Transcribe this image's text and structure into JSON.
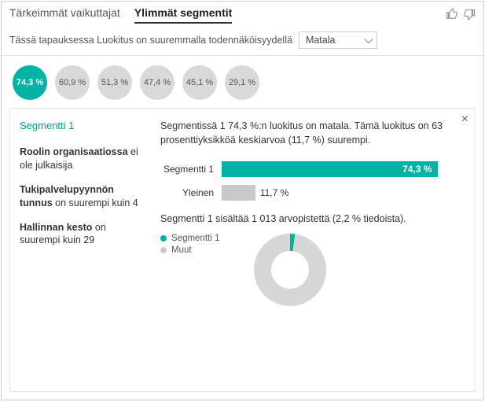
{
  "tabs": {
    "tab1": "Tärkeimmät vaikuttajat",
    "tab2": "Ylimmät segmentit"
  },
  "sub_sentence": "Tässä tapauksessa Luokitus on suuremmalla todennäköisyydellä",
  "dropdown_value": "Matala",
  "bubbles": [
    "74,3 %",
    "60,9 %",
    "51,3 %",
    "47,4 %",
    "45,1 %",
    "29,1 %"
  ],
  "segment": {
    "title": "Segmentti 1",
    "conditions": [
      {
        "bold": "Roolin organisaatiossa",
        "rest": " ei ole julkaisija"
      },
      {
        "bold": "Tukipalvelupyynnön tunnus",
        "rest": " on suurempi kuin 4"
      },
      {
        "bold": "Hallinnan kesto",
        "rest": " on suurempi kuin 29"
      }
    ]
  },
  "summary": "Segmentissä 1 74,3 %:n luokitus on matala. Tämä luokitus on 63 prosenttiyksikköä keskiarvoa (11,7 %) suurempi.",
  "bars": {
    "seg_label": "Segmentti 1",
    "seg_value": "74,3 %",
    "all_label": "Yleinen",
    "all_value": "11,7 %"
  },
  "points_text": "Segmentti 1 sisältää 1 013 arvopistettä (2,2 % tiedoista).",
  "legend": {
    "seg": "Segmentti 1",
    "other": "Muut"
  },
  "chart_data": {
    "type": "bar",
    "title": "",
    "categories": [
      "Segmentti 1",
      "Yleinen"
    ],
    "values": [
      74.3,
      11.7
    ],
    "xlabel": "",
    "ylabel": "%",
    "ylim": [
      0,
      100
    ],
    "donut": {
      "type": "pie",
      "series": [
        {
          "name": "Segmentti 1",
          "value": 2.2
        },
        {
          "name": "Muut",
          "value": 97.8
        }
      ]
    }
  }
}
